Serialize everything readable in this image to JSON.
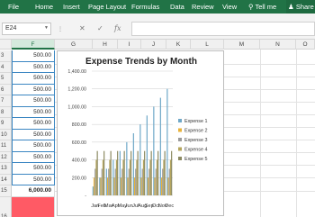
{
  "ribbon": {
    "tabs": [
      "File",
      "Home",
      "Insert",
      "Page Layout",
      "Formulas",
      "Data",
      "Review",
      "View"
    ],
    "tell_me": "Tell me",
    "share": "Share"
  },
  "formula_bar": {
    "name_box": "E24",
    "cancel_icon": "cancel-icon",
    "enter_icon": "check-icon",
    "fx": "fx",
    "value": ""
  },
  "columns": [
    "F",
    "G",
    "H",
    "I",
    "J",
    "K",
    "L",
    "M",
    "N",
    "O"
  ],
  "active_column": "F",
  "rows": [
    {
      "num": "3",
      "value": "500.00"
    },
    {
      "num": "4",
      "value": "500.00"
    },
    {
      "num": "5",
      "value": "500.00"
    },
    {
      "num": "6",
      "value": "500.00"
    },
    {
      "num": "7",
      "value": "500.00"
    },
    {
      "num": "8",
      "value": "500.00"
    },
    {
      "num": "9",
      "value": "500.00"
    },
    {
      "num": "10",
      "value": "500.00"
    },
    {
      "num": "11",
      "value": "500.00"
    },
    {
      "num": "12",
      "value": "500.00"
    },
    {
      "num": "13",
      "value": "500.00"
    },
    {
      "num": "14",
      "value": "500.00"
    },
    {
      "num": "15",
      "value": "6,000.00"
    },
    {
      "num": "16",
      "value": ""
    }
  ],
  "highlight_color": "#ff5a65",
  "chart_data": {
    "type": "bar",
    "title": "Expense Trends by Month",
    "categories": [
      "Jan",
      "Feb",
      "Mar",
      "Apr",
      "May",
      "Jun",
      "Jul",
      "Aug",
      "Sep",
      "Oct",
      "Nov",
      "Dec"
    ],
    "ylim": [
      0,
      1400
    ],
    "yticks": [
      "1,400.00",
      "1,200.00",
      "1,000.00",
      "800.00",
      "600.00",
      "400.00",
      "200.00",
      "-"
    ],
    "grid": true,
    "legend_position": "right",
    "series": [
      {
        "name": "Expense 1",
        "color": "#6fa8c8",
        "values": [
          100,
          200,
          300,
          400,
          500,
          600,
          700,
          800,
          900,
          1000,
          1100,
          1200
        ]
      },
      {
        "name": "Expense 2",
        "color": "#e8b23a",
        "values": [
          200,
          200,
          200,
          200,
          200,
          200,
          200,
          200,
          200,
          200,
          200,
          200
        ]
      },
      {
        "name": "Expense 3",
        "color": "#9a9a9a",
        "values": [
          300,
          300,
          300,
          300,
          300,
          300,
          300,
          300,
          300,
          300,
          300,
          300
        ]
      },
      {
        "name": "Expense 4",
        "color": "#b5a55c",
        "values": [
          400,
          400,
          400,
          400,
          400,
          400,
          400,
          400,
          400,
          400,
          400,
          400
        ]
      },
      {
        "name": "Expense 5",
        "color": "#8c8a62",
        "values": [
          500,
          500,
          500,
          500,
          500,
          500,
          500,
          500,
          500,
          500,
          500,
          500
        ]
      }
    ]
  }
}
